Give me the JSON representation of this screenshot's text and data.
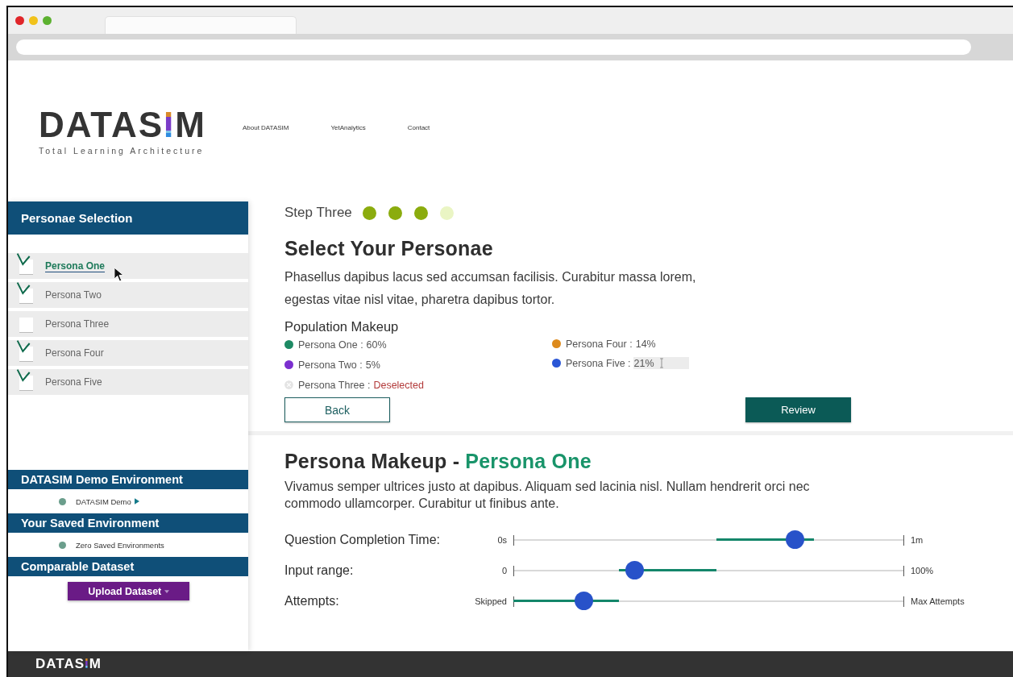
{
  "logo": {
    "text": "DATASIM",
    "tagline": "Total Learning Architecture"
  },
  "nav": [
    "About DATASIM",
    "YetAnalytics",
    "Contact"
  ],
  "sidebar": {
    "title": "Personae Selection",
    "personas": [
      {
        "label": "Persona One",
        "checked": true,
        "selected": true
      },
      {
        "label": "Persona Two",
        "checked": true,
        "selected": false
      },
      {
        "label": "Persona Three",
        "checked": false,
        "selected": false
      },
      {
        "label": "Persona Four",
        "checked": true,
        "selected": false
      },
      {
        "label": "Persona Five",
        "checked": true,
        "selected": false
      }
    ],
    "sections": [
      {
        "title": "DATASIM Demo Environment",
        "kind": "item",
        "item": "DATASIM Demo",
        "play": true
      },
      {
        "title": "Your Saved Environment",
        "kind": "item",
        "item": "Zero Saved Environments",
        "play": false
      },
      {
        "title": "Comparable Dataset",
        "kind": "button",
        "button": "Upload Dataset"
      }
    ]
  },
  "step": {
    "label": "Step Three",
    "dots": [
      {
        "done": true
      },
      {
        "done": true
      },
      {
        "done": true
      },
      {
        "done": false
      }
    ]
  },
  "select": {
    "title": "Select Your Personae",
    "text": "Phasellus dapibus lacus sed accumsan facilisis. Curabitur massa lorem, egestas vitae nisl vitae, pharetra dapibus tortor.",
    "population_title": "Population Makeup",
    "columns": [
      [
        {
          "label": "Persona One :",
          "value": "60%",
          "color": "#1e8a64",
          "deselected": false,
          "editing": false
        },
        {
          "label": "Persona Two :",
          "value": "5%",
          "color": "#7b2fcf",
          "deselected": false,
          "editing": false
        },
        {
          "label": "Persona Three :",
          "value": "Deselected",
          "color": "#e4e4e4",
          "deselected": true,
          "editing": false
        }
      ],
      [
        {
          "label": "Persona Four :",
          "value": "14%",
          "color": "#dd8a1c",
          "deselected": false,
          "editing": false
        },
        {
          "label": "Persona Five :",
          "value": "21%",
          "color": "#2a56d6",
          "deselected": false,
          "editing": true
        }
      ]
    ],
    "back": "Back",
    "review": "Review"
  },
  "makeup": {
    "title": "Persona Makeup -",
    "persona": "Persona One",
    "text": "Vivamus semper ultrices justo at dapibus. Aliquam sed lacinia nisl. Nullam hendrerit orci nec commodo ullamcorper. Curabitur ut finibus ante.",
    "sliders": [
      {
        "label": "Question Completion Time:",
        "min": "0s",
        "max": "1m",
        "level": 0.72
      },
      {
        "label": "Input range:",
        "min": "0",
        "max": "100%",
        "level": 0.31
      },
      {
        "label": "Attempts:",
        "min": "Skipped",
        "max": "Max Attempts",
        "level": 0.18
      }
    ]
  },
  "footer": {
    "logo": "DATASIM"
  }
}
